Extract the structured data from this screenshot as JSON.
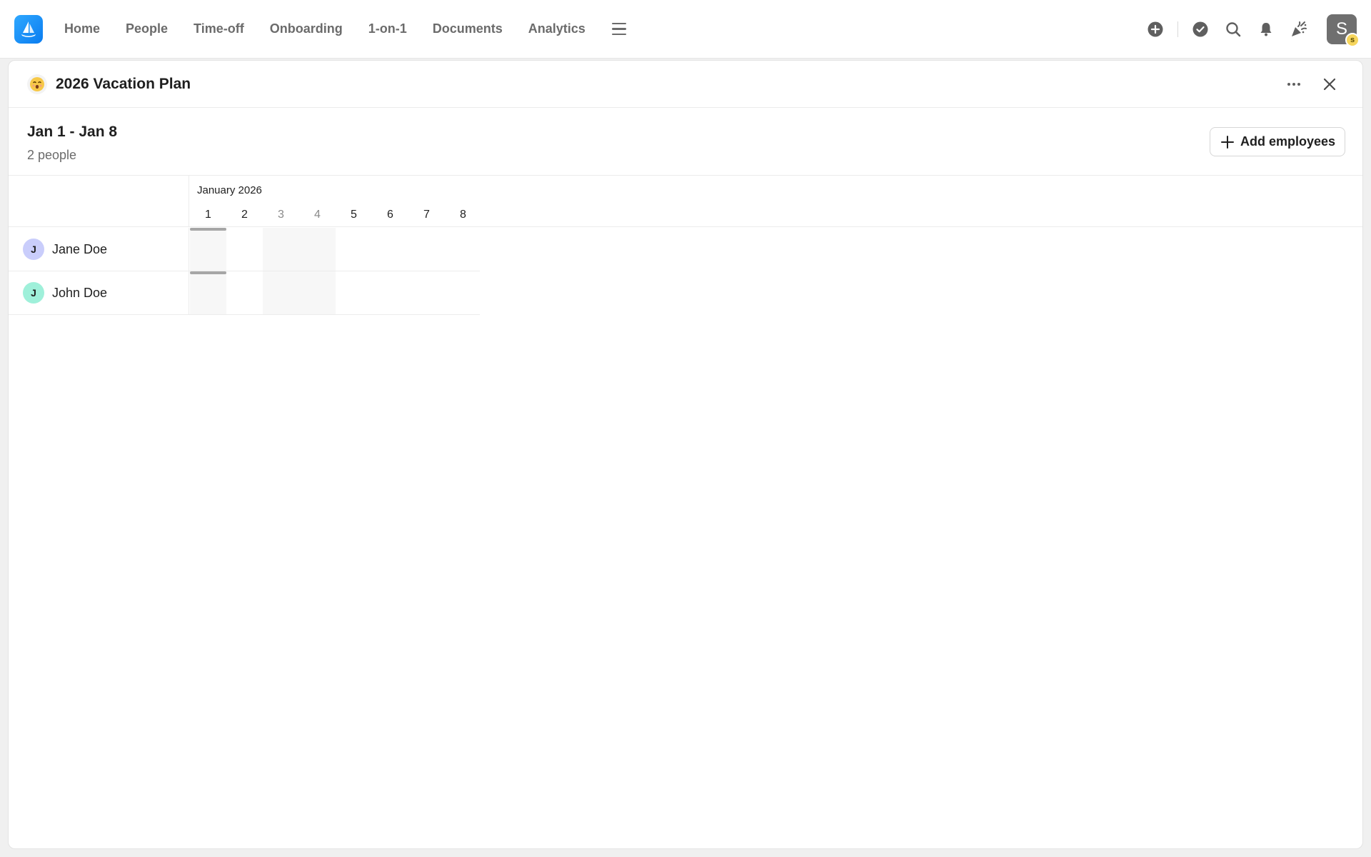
{
  "nav": {
    "links": [
      "Home",
      "People",
      "Time-off",
      "Onboarding",
      "1-on-1",
      "Documents",
      "Analytics"
    ],
    "user_initial": "S",
    "user_badge": "s"
  },
  "panel": {
    "title": "2026 Vacation Plan",
    "range_title": "Jan 1 - Jan 8",
    "people_count": "2 people",
    "add_button": "Add employees"
  },
  "calendar": {
    "month": "January 2026",
    "days": [
      "1",
      "2",
      "3",
      "4",
      "5",
      "6",
      "7",
      "8"
    ],
    "weekend_days": [
      "3",
      "4"
    ],
    "holiday_days": [
      "1"
    ]
  },
  "employees": [
    {
      "initial": "J",
      "name": "Jane Doe",
      "avatar_color": "#c9cdfb"
    },
    {
      "initial": "J",
      "name": "John Doe",
      "avatar_color": "#9ff0da"
    }
  ],
  "colors": {
    "brand": "#0a7cf0",
    "avatar_badge": "#f6d55c"
  }
}
